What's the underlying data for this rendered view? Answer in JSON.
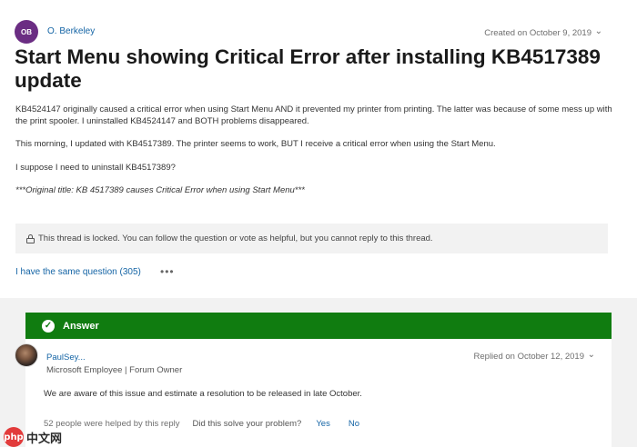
{
  "post": {
    "author_initials": "OB",
    "author_name": "O. Berkeley",
    "created_on": "Created on October 9, 2019",
    "title": "Start Menu showing Critical Error after installing KB4517389 update",
    "paragraphs": [
      "KB4524147 originally caused a critical error when using Start Menu AND it prevented my printer from printing. The latter was because of some mess up with the print spooler. I uninstalled KB4524147 and BOTH problems disappeared.",
      "This morning, I updated with KB4517389. The printer seems to work, BUT I receive a critical error when using the Start Menu.",
      "I suppose I need to uninstall KB4517389?",
      "***Original title: KB 4517389 causes Critical Error when using Start Menu***"
    ]
  },
  "locked_notice": "This thread is locked. You can follow the question or vote as helpful, but you cannot reply to this thread.",
  "same_question": "I have the same question (305)",
  "more_options": "•••",
  "answer": {
    "header_label": "Answer",
    "replier_name": "PaulSey...",
    "replier_role": "Microsoft Employee | Forum Owner",
    "replied_on": "Replied on October 12, 2019",
    "text": "We are aware of this issue and estimate a resolution to be released in late October.",
    "helped_count": "52 people were helped by this reply",
    "helped_question": "Did this solve your problem?",
    "yes_label": "Yes",
    "no_label": "No"
  },
  "watermark": {
    "logo_text": "php",
    "text": "中文网"
  },
  "colors": {
    "link": "#1464a5",
    "answer_green": "#107c10",
    "avatar_purple": "#6b2d83"
  }
}
